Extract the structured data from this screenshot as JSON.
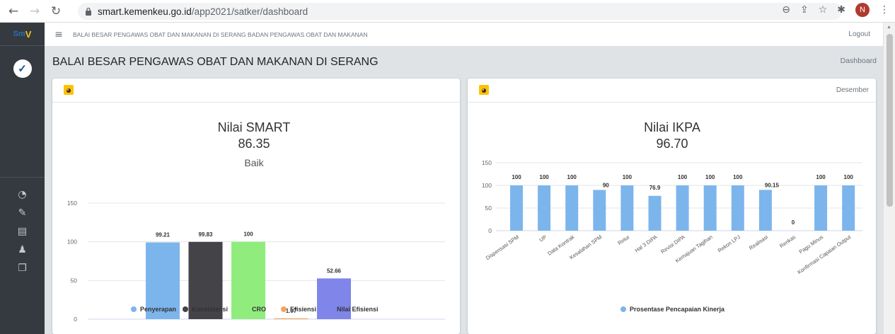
{
  "browser": {
    "url_host": "smart.kemenkeu.go.id",
    "url_path": "/app2021/satker/dashboard",
    "profile_initial": "N"
  },
  "sidebar": {
    "brand_text": "SMART",
    "menu_icons": [
      "dashboard-icon",
      "edit-icon",
      "document-icon",
      "user-icon",
      "copy-icon"
    ]
  },
  "topbar": {
    "title": "BALAI BESAR PENGAWAS OBAT DAN MAKANAN DI SERANG BADAN PENGAWAS OBAT DAN MAKANAN",
    "logout_label": "Logout"
  },
  "page": {
    "title": "BALAI BESAR PENGAWAS OBAT DAN MAKANAN DI SERANG",
    "breadcrumb": "Dashboard"
  },
  "cards": {
    "smart": {
      "month": ""
    },
    "ikpa": {
      "month": "Desember"
    }
  },
  "chart_data": [
    {
      "type": "bar",
      "title": "Nilai SMART",
      "value_text": "86.35",
      "subtitle": "Baik",
      "ylim": [
        0,
        150
      ],
      "yticks": [
        0,
        50,
        100,
        150
      ],
      "grid": true,
      "legend_position": "bottom",
      "series": [
        {
          "name": "Penyerapan",
          "value": 99.21,
          "label": "99.21",
          "color": "#7cb5ec"
        },
        {
          "name": "Konsistensi",
          "value": 99.83,
          "label": "99.83",
          "color": "#434348"
        },
        {
          "name": "CRO",
          "value": 100,
          "label": "100",
          "color": "#90ed7d"
        },
        {
          "name": "Efisiensi",
          "value": 1.07,
          "label": "1.07",
          "color": "#f7a35c"
        },
        {
          "name": "Nilai Efisiensi",
          "value": 52.66,
          "label": "52.66",
          "color": "#8085e9"
        }
      ]
    },
    {
      "type": "bar",
      "title": "Nilai IKPA",
      "value_text": "96.70",
      "ylim": [
        0,
        150
      ],
      "yticks": [
        0,
        50,
        100,
        150
      ],
      "grid": true,
      "legend_position": "bottom",
      "categories": [
        "Dispensasi SPM",
        "UP",
        "Data Kontrak",
        "Kesalahan SPM",
        "Retur",
        "Hal 3 DIPA",
        "Revisi DIPA",
        "Kemajuan Tagihan",
        "Rekon LPJ",
        "Realisasi",
        "Renkas",
        "Pagu Minus",
        "Konfirmasi Capaian Output"
      ],
      "series": [
        {
          "name": "Prosentase Pencapaian Kinerja",
          "color": "#7cb5ec",
          "values": [
            100,
            100,
            100,
            90,
            100,
            76.9,
            100,
            100,
            100,
            90.15,
            0,
            100,
            100
          ],
          "labels": [
            "100",
            "100",
            "100",
            "90",
            "100",
            "76.9",
            "100",
            "100",
            "100",
            "90.15",
            "0",
            "100",
            "100"
          ]
        }
      ]
    }
  ]
}
